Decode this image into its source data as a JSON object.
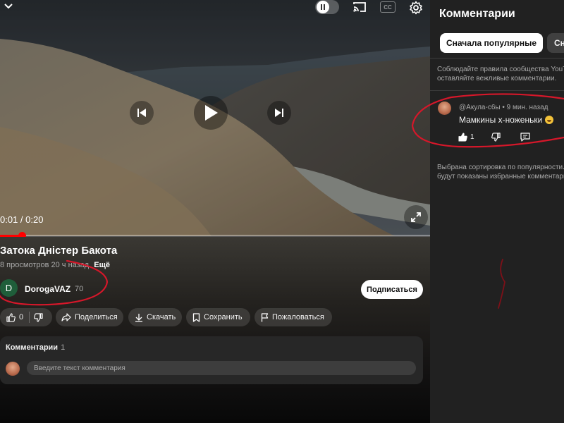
{
  "player": {
    "time": "0:01 / 0:20",
    "progress": 0.05,
    "cc_label": "CC"
  },
  "video": {
    "title": "Затока Дністер Бакота",
    "views": "8 просмотров",
    "age": "20 ч назад",
    "more": "Ещё"
  },
  "channel": {
    "avatar_letter": "D",
    "name": "DorogaVAZ",
    "subscribers": "70",
    "subscribe_label": "Подписаться"
  },
  "actions": {
    "like_count": "0",
    "share": "Поделиться",
    "download": "Скачать",
    "save": "Сохранить",
    "report": "Пожаловаться"
  },
  "comments_card": {
    "title": "Комментарии",
    "count": "1",
    "placeholder": "Введите текст комментария"
  },
  "panel": {
    "title": "Комментарии",
    "sort_popular": "Сначала популярные",
    "sort_new": "Сначала новые",
    "rules_line1": "Соблюдайте правила сообщества YouTube и",
    "rules_line2": "оставляйте вежливые комментарии.",
    "comment": {
      "author": "@Акула-с6ы",
      "time": "9 мин. назад",
      "text": "Мамкины х-ноженьки",
      "likes": "1"
    },
    "sort_note_line1": "Выбрана сортировка по популярности. Будут",
    "sort_note_line2": "будут показаны избранные комментарии."
  },
  "colors": {
    "accent_red": "#ff0000",
    "annotation_red": "#d6172a"
  }
}
